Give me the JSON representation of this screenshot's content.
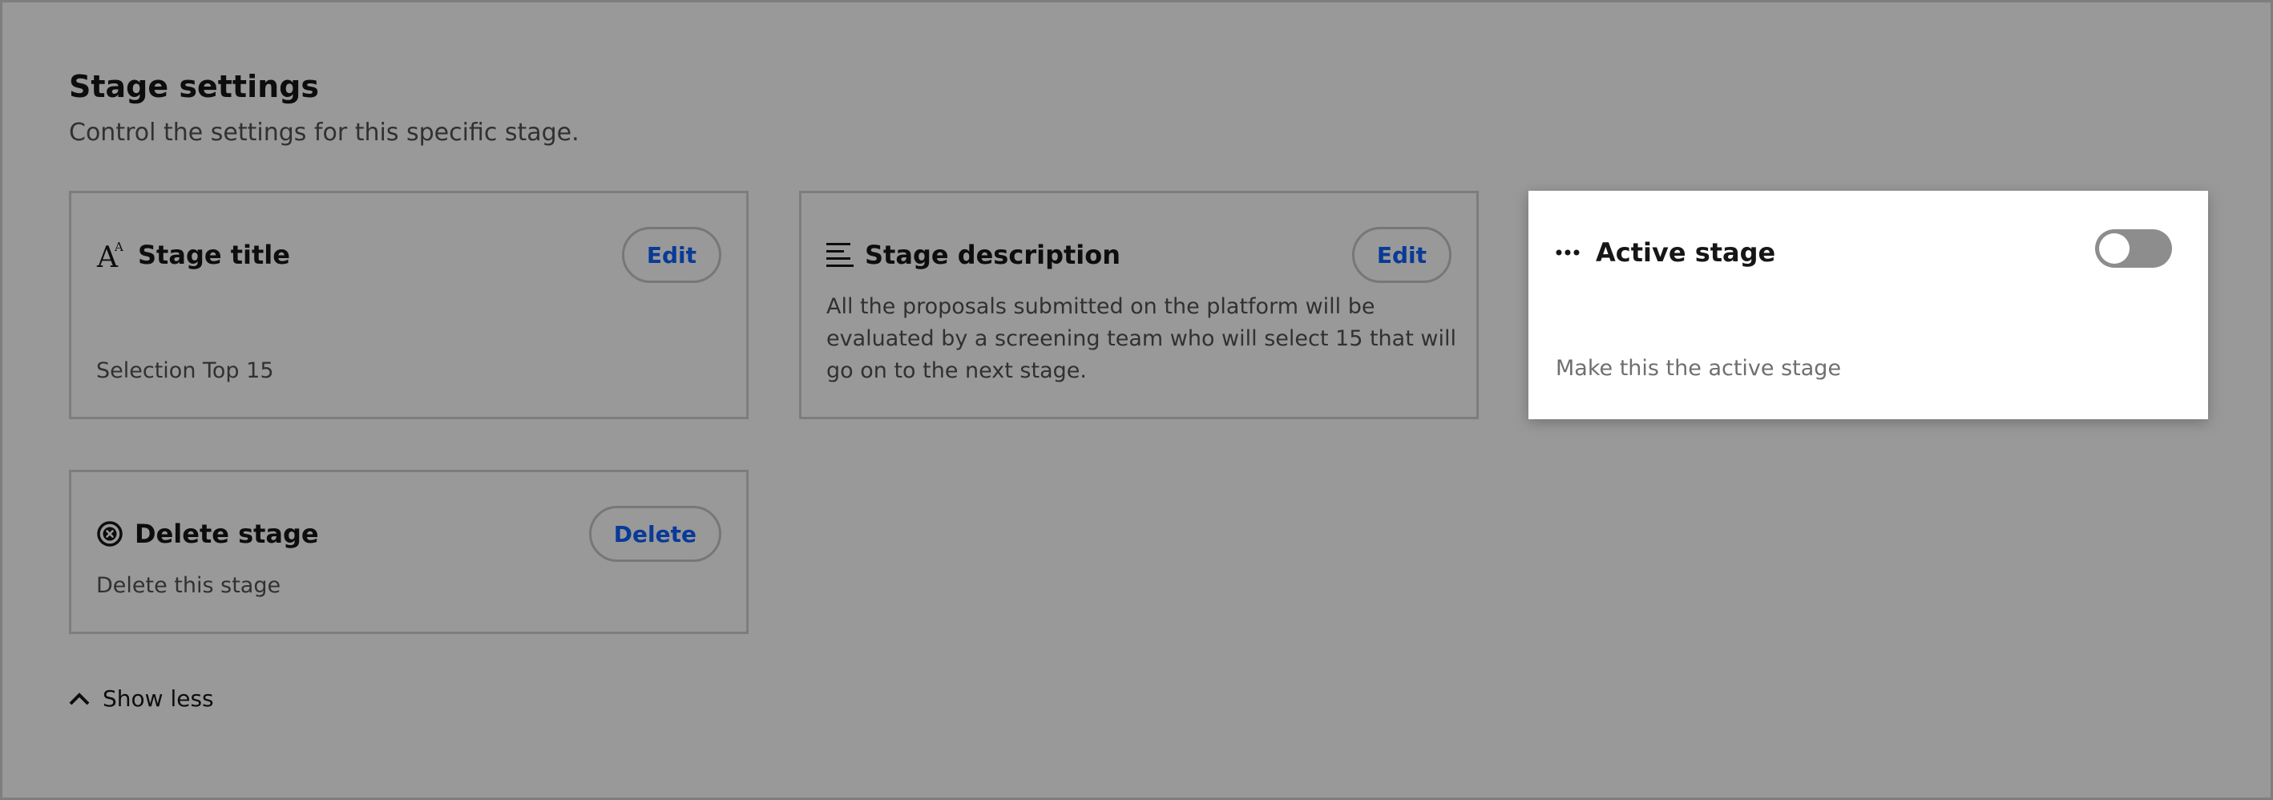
{
  "header": {
    "title": "Stage settings",
    "subtitle": "Control the settings for this specific stage."
  },
  "cards": {
    "stage_title": {
      "icon": "text-font-icon",
      "title": "Stage title",
      "button_label": "Edit",
      "value": "Selection Top 15"
    },
    "stage_description": {
      "icon": "align-left-icon",
      "title": "Stage description",
      "button_label": "Edit",
      "value": "All the proposals submitted on the platform will be evaluated by a screening team who will select 15 that will go on to the next stage."
    },
    "active_stage": {
      "icon": "overflow-dots-icon",
      "title": "Active stage",
      "toggle_on": false,
      "description": "Make this the active stage"
    },
    "delete_stage": {
      "icon": "close-circle-icon",
      "title": "Delete stage",
      "button_label": "Delete",
      "description": "Delete this stage"
    }
  },
  "footer": {
    "show_less_icon": "chevron-up-icon",
    "show_less_label": "Show less"
  },
  "colors": {
    "accent": "#0f62fe",
    "text_primary": "#161616",
    "text_secondary": "#525252",
    "border": "#d0d0d0",
    "toggle_off": "#8d8d8d"
  }
}
